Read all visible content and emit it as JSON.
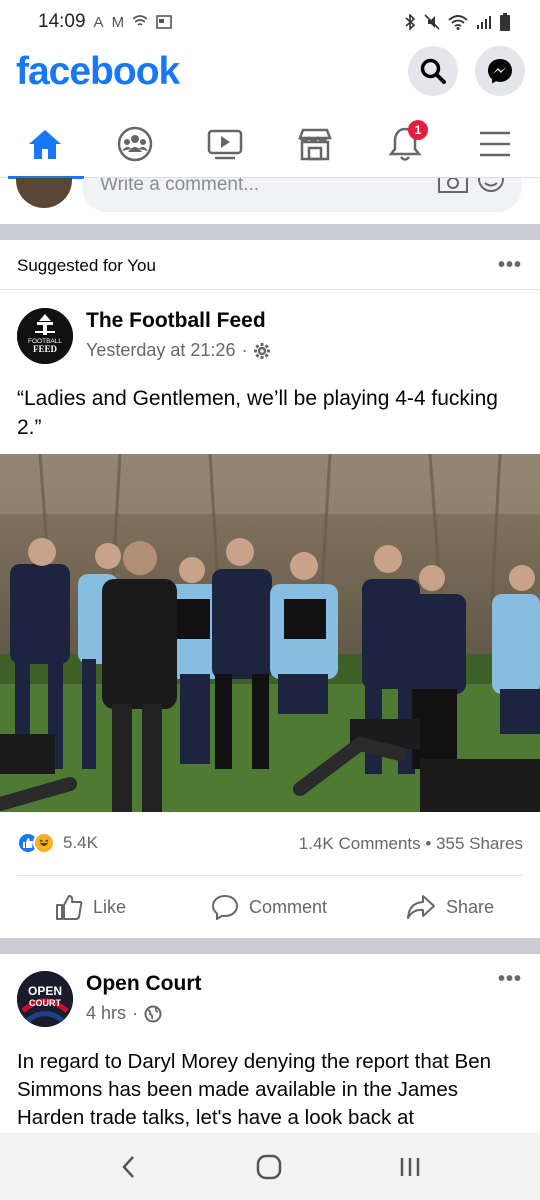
{
  "status_bar": {
    "time": "14:09",
    "left_icons": [
      "A",
      "M"
    ]
  },
  "header": {
    "logo": "facebook"
  },
  "comment_box": {
    "placeholder": "Write a comment..."
  },
  "suggested": {
    "label": "Suggested for You"
  },
  "post1": {
    "page_name": "The Football Feed",
    "avatar_text_1": "FOOTBALL",
    "avatar_text_2": "FEED",
    "timestamp": "Yesterday at 21:26",
    "text": "“Ladies and Gentlemen, we’ll be playing 4-4 fucking 2.”",
    "reaction_count": "5.4K",
    "comments_shares": "1.4K Comments • 355 Shares",
    "actions": {
      "like": "Like",
      "comment": "Comment",
      "share": "Share"
    }
  },
  "post2": {
    "page_name": "Open Court",
    "avatar_text_1": "OPEN",
    "avatar_text_2": "COURT",
    "timestamp": "4 hrs",
    "text": "In regard to Daryl Morey denying the report that Ben Simmons has been made available in the James Harden trade talks, let's have a look back at"
  },
  "nav": {
    "notifications_badge": "1"
  },
  "colors": {
    "brand": "#1877f2",
    "badge": "#e41e3f"
  }
}
